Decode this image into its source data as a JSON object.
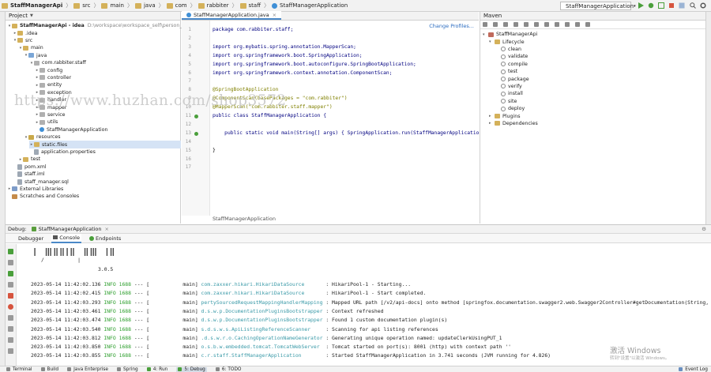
{
  "navbar": {
    "crumbs": [
      "StaffManagerApi",
      "src",
      "main",
      "java",
      "com",
      "rabbiter",
      "staff",
      "StaffManagerApplication"
    ],
    "run_config": "StaffManagerApplication"
  },
  "project": {
    "title": "Project",
    "tree": [
      {
        "label": "StaffManagerApi - idea",
        "extra": "D:\\workspace\\workspace_self\\person_manager_",
        "indent": 0,
        "icon": "folder",
        "tw": "▾",
        "bold": true
      },
      {
        "label": ".idea",
        "indent": 1,
        "icon": "folder",
        "tw": "▸"
      },
      {
        "label": "src",
        "indent": 1,
        "icon": "folder",
        "tw": "▾"
      },
      {
        "label": "main",
        "indent": 2,
        "icon": "folder",
        "tw": "▾"
      },
      {
        "label": "java",
        "indent": 3,
        "icon": "src",
        "tw": "▾"
      },
      {
        "label": "com.rabbiter.staff",
        "indent": 4,
        "icon": "pkg",
        "tw": "▾"
      },
      {
        "label": "config",
        "indent": 5,
        "icon": "pkg",
        "tw": "▸"
      },
      {
        "label": "controller",
        "indent": 5,
        "icon": "pkg",
        "tw": "▸"
      },
      {
        "label": "entity",
        "indent": 5,
        "icon": "pkg",
        "tw": "▸"
      },
      {
        "label": "exception",
        "indent": 5,
        "icon": "pkg",
        "tw": "▸"
      },
      {
        "label": "handler",
        "indent": 5,
        "icon": "pkg",
        "tw": "▸"
      },
      {
        "label": "mapper",
        "indent": 5,
        "icon": "pkg",
        "tw": "▸"
      },
      {
        "label": "service",
        "indent": 5,
        "icon": "pkg",
        "tw": "▸"
      },
      {
        "label": "utils",
        "indent": 5,
        "icon": "pkg",
        "tw": "▸"
      },
      {
        "label": "StaffManagerApplication",
        "indent": 5,
        "icon": "cls",
        "tw": ""
      },
      {
        "label": "resources",
        "indent": 3,
        "icon": "res",
        "tw": "▾"
      },
      {
        "label": "static.files",
        "indent": 4,
        "icon": "folder",
        "tw": "▸",
        "selected": true
      },
      {
        "label": "application.properties",
        "indent": 4,
        "icon": "file",
        "tw": ""
      },
      {
        "label": "test",
        "indent": 2,
        "icon": "folder",
        "tw": "▸"
      },
      {
        "label": "pom.xml",
        "indent": 1,
        "icon": "file",
        "tw": ""
      },
      {
        "label": "staff.iml",
        "indent": 1,
        "icon": "file",
        "tw": ""
      },
      {
        "label": "staff_manager.sql",
        "indent": 1,
        "icon": "file",
        "tw": ""
      },
      {
        "label": "External Libraries",
        "indent": 0,
        "icon": "lib",
        "tw": "▸"
      },
      {
        "label": "Scratches and Consoles",
        "indent": 0,
        "icon": "scr",
        "tw": ""
      }
    ]
  },
  "editor": {
    "tab": "StaffManagerApplication.java",
    "change_profiles": "Change Profiles...",
    "line_numbers": [
      "1",
      "2",
      "3",
      "4",
      "5",
      "6",
      "7",
      "8",
      "9",
      "10",
      "11",
      "12",
      "13",
      "14",
      "15",
      "16",
      "17"
    ],
    "breadcrumb": "StaffManagerApplication",
    "lines": [
      "package com.rabbiter.staff;",
      "",
      "import org.mybatis.spring.annotation.MapperScan;",
      "import org.springframework.boot.SpringApplication;",
      "import org.springframework.boot.autoconfigure.SpringBootApplication;",
      "import org.springframework.context.annotation.ComponentScan;",
      "",
      "@SpringBootApplication",
      "@ComponentScan(basePackages = \"com.rabbiter\")",
      "@MapperScan(\"com.rabbiter.staff.mapper\")",
      "public class StaffManagerApplication {",
      "",
      "    public static void main(String[] args) { SpringApplication.run(StaffManagerApplication.class, args); }",
      "",
      "}"
    ]
  },
  "maven": {
    "title": "Maven",
    "items": [
      {
        "label": "StaffManagerApi",
        "indent": 0,
        "tw": "▾",
        "icon": "m"
      },
      {
        "label": "Lifecycle",
        "indent": 1,
        "tw": "▾",
        "icon": "folder"
      },
      {
        "label": "clean",
        "indent": 2,
        "tw": "",
        "icon": "gear"
      },
      {
        "label": "validate",
        "indent": 2,
        "tw": "",
        "icon": "gear"
      },
      {
        "label": "compile",
        "indent": 2,
        "tw": "",
        "icon": "gear"
      },
      {
        "label": "test",
        "indent": 2,
        "tw": "",
        "icon": "gear"
      },
      {
        "label": "package",
        "indent": 2,
        "tw": "",
        "icon": "gear"
      },
      {
        "label": "verify",
        "indent": 2,
        "tw": "",
        "icon": "gear"
      },
      {
        "label": "install",
        "indent": 2,
        "tw": "",
        "icon": "gear"
      },
      {
        "label": "site",
        "indent": 2,
        "tw": "",
        "icon": "gear"
      },
      {
        "label": "deploy",
        "indent": 2,
        "tw": "",
        "icon": "gear"
      },
      {
        "label": "Plugins",
        "indent": 1,
        "tw": "▸",
        "icon": "folder"
      },
      {
        "label": "Dependencies",
        "indent": 1,
        "tw": "▸",
        "icon": "folder"
      }
    ]
  },
  "debug": {
    "label": "Debug:",
    "config_tab": "StaffManagerApplication",
    "tabs": [
      "Debugger",
      "Console",
      "Endpoints"
    ],
    "banner_line1": "Ⅰ ⅢⅡⅡⅠⅡ ⅡⅢ ⅠⅡ",
    "banner_line2": "/           |",
    "version": "3.0.5",
    "logs": [
      {
        "ts": "2023-05-14 11:42:02.136",
        "lvl": "INFO",
        "pid": "1688",
        "sep": "---",
        "thread": "[           main]",
        "logger": "com.zaxxer.hikari.HikariDataSource      ",
        "msg": ": HikariPool-1 - Starting..."
      },
      {
        "ts": "2023-05-14 11:42:02.415",
        "lvl": "INFO",
        "pid": "1688",
        "sep": "---",
        "thread": "[           main]",
        "logger": "com.zaxxer.hikari.HikariDataSource      ",
        "msg": ": HikariPool-1 - Start completed."
      },
      {
        "ts": "2023-05-14 11:42:03.293",
        "lvl": "INFO",
        "pid": "1688",
        "sep": "---",
        "thread": "[           main]",
        "logger": "pertySourcedRequestMappingHandlerMapping",
        "msg": ": Mapped URL path [/v2/api-docs] onto method [springfox.documentation.swagger2.web.Swagger2Controller#getDocumentation(String, H"
      },
      {
        "ts": "2023-05-14 11:42:03.461",
        "lvl": "INFO",
        "pid": "1688",
        "sep": "---",
        "thread": "[           main]",
        "logger": "d.s.w.p.DocumentationPluginsBootstrapper",
        "msg": ": Context refreshed"
      },
      {
        "ts": "2023-05-14 11:42:03.474",
        "lvl": "INFO",
        "pid": "1688",
        "sep": "---",
        "thread": "[           main]",
        "logger": "d.s.w.p.DocumentationPluginsBootstrapper",
        "msg": ": Found 1 custom documentation plugin(s)"
      },
      {
        "ts": "2023-05-14 11:42:03.540",
        "lvl": "INFO",
        "pid": "1688",
        "sep": "---",
        "thread": "[           main]",
        "logger": "s.d.s.w.s.ApiListingReferenceScanner    ",
        "msg": ": Scanning for api listing references"
      },
      {
        "ts": "2023-05-14 11:42:03.812",
        "lvl": "INFO",
        "pid": "1688",
        "sep": "---",
        "thread": "[           main]",
        "logger": ".d.s.w.r.o.CachingOperationNameGenerator",
        "msg": ": Generating unique operation named: updateClerkUsingPUT_1"
      },
      {
        "ts": "2023-05-14 11:42:03.850",
        "lvl": "INFO",
        "pid": "1688",
        "sep": "---",
        "thread": "[           main]",
        "logger": "o.s.b.w.embedded.tomcat.TomcatWebServer ",
        "msg": ": Tomcat started on port(s): 8001 (http) with context path ''"
      },
      {
        "ts": "2023-05-14 11:42:03.855",
        "lvl": "INFO",
        "pid": "1688",
        "sep": "---",
        "thread": "[           main]",
        "logger": "c.r.staff.StaffManagerApplication       ",
        "msg": ": Started StaffManagerApplication in 3.741 seconds (JVM running for 4.826)"
      }
    ]
  },
  "bottombar": {
    "items": [
      "Terminal",
      "Build",
      "Java Enterprise",
      "Spring",
      "4: Run",
      "5: Debug",
      "6: TODO"
    ],
    "event_log": "Event Log"
  },
  "watermark": "https://www.huzhan.com/shop3572",
  "windows": {
    "line1": "激活 Windows",
    "line2": "转到\"设置\"以激活 Windows。"
  }
}
